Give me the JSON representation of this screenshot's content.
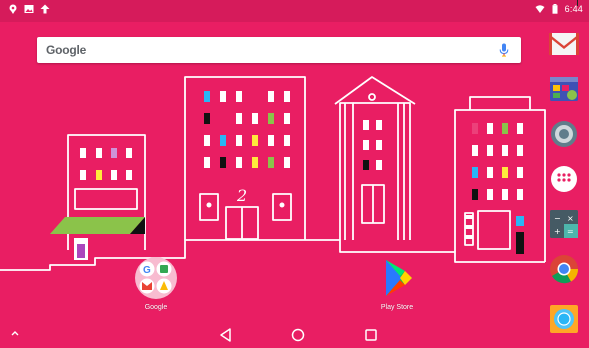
{
  "status_bar": {
    "left_icons": [
      "location-icon",
      "image-icon",
      "upload-icon"
    ],
    "right_icons": [
      "wifi-icon",
      "battery-icon"
    ],
    "time": "6:44"
  },
  "search": {
    "logo": "Google",
    "mic_icon": "mic-icon"
  },
  "home_apps": [
    {
      "label": "Google",
      "icon": "google-folder-icon"
    },
    {
      "label": "Play Store",
      "icon": "play-store-icon"
    }
  ],
  "dock": [
    "gmail-icon",
    "photo-gallery-icon",
    "settings-icon",
    "app-drawer-icon",
    "calculator-icon",
    "chrome-icon",
    "camera-icon"
  ],
  "nav": [
    "back-icon",
    "home-icon",
    "recents-icon"
  ],
  "colors": {
    "wallpaper": "#e91e63",
    "line_art": "#ffffff",
    "awning_green": "#8bc34a"
  }
}
